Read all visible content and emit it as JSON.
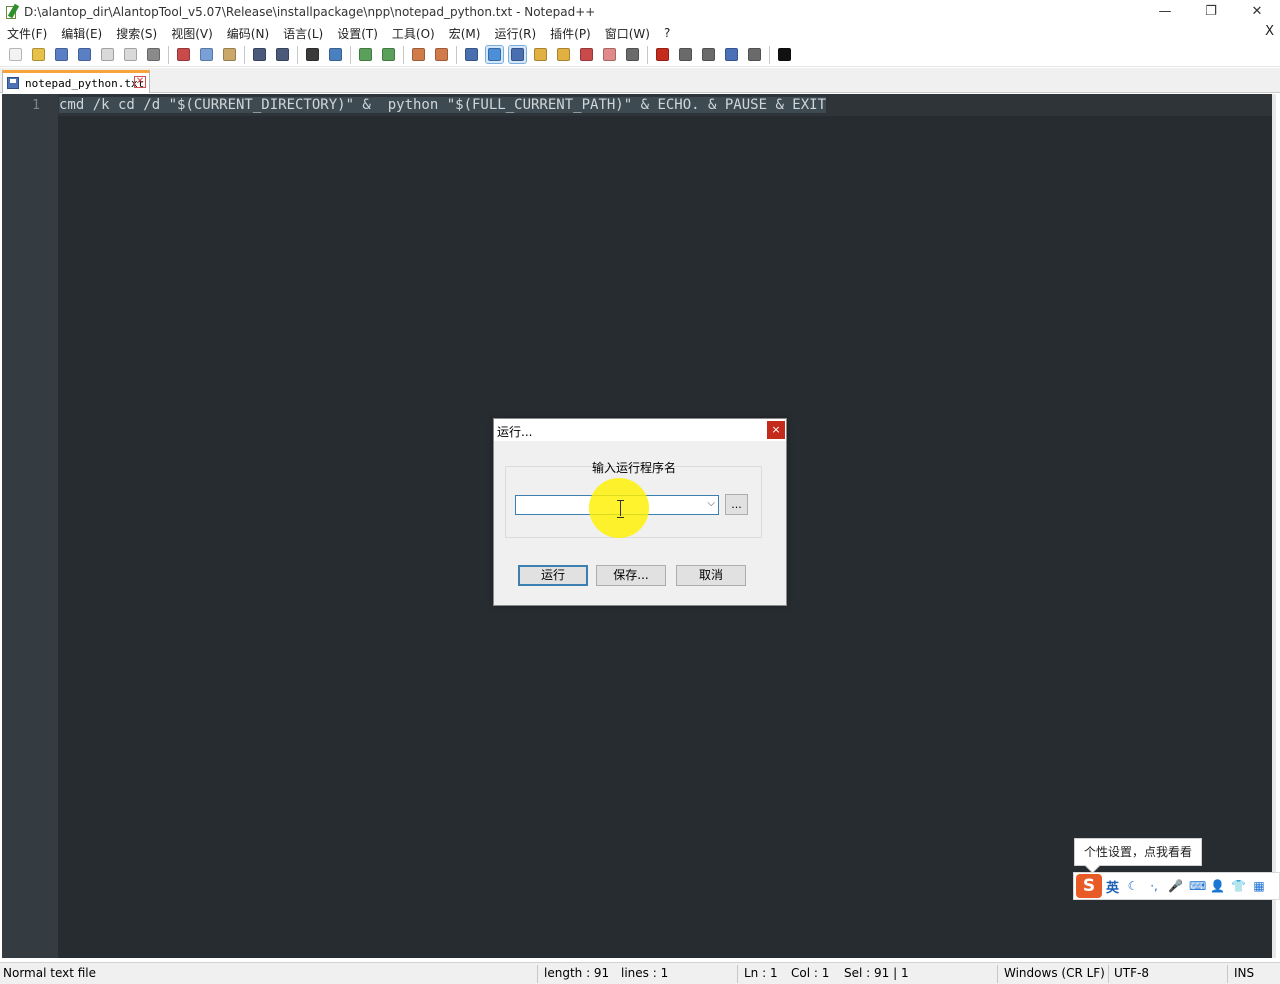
{
  "window": {
    "title": "D:\\alantop_dir\\AlantopTool_v5.07\\Release\\installpackage\\npp\\notepad_python.txt - Notepad++",
    "minimize": "—",
    "restore": "❐",
    "close": "✕"
  },
  "menu": {
    "items": [
      "文件(F)",
      "编辑(E)",
      "搜索(S)",
      "视图(V)",
      "编码(N)",
      "语言(L)",
      "设置(T)",
      "工具(O)",
      "宏(M)",
      "运行(R)",
      "插件(P)",
      "窗口(W)",
      "?"
    ],
    "close": "X"
  },
  "toolbar": {
    "icons": [
      {
        "name": "new-file-icon",
        "color": "#f2f2f2"
      },
      {
        "name": "open-file-icon",
        "color": "#e8c14a"
      },
      {
        "name": "save-icon",
        "color": "#5b7fc4"
      },
      {
        "name": "save-all-icon",
        "color": "#5b7fc4"
      },
      {
        "name": "close-icon",
        "color": "#d9d9d9"
      },
      {
        "name": "close-all-icon",
        "color": "#d9d9d9"
      },
      {
        "name": "print-icon",
        "color": "#8a8a8a"
      },
      {
        "sep": true
      },
      {
        "name": "cut-icon",
        "color": "#c94a4a"
      },
      {
        "name": "copy-icon",
        "color": "#7aa0d8"
      },
      {
        "name": "paste-icon",
        "color": "#c9a86a"
      },
      {
        "sep": true
      },
      {
        "name": "undo-icon",
        "color": "#4b5a7a"
      },
      {
        "name": "redo-icon",
        "color": "#4b5a7a"
      },
      {
        "sep": true
      },
      {
        "name": "find-icon",
        "color": "#3a3a3a"
      },
      {
        "name": "replace-icon",
        "color": "#4a80c0"
      },
      {
        "sep": true
      },
      {
        "name": "zoom-in-icon",
        "color": "#5aa05a"
      },
      {
        "name": "zoom-out-icon",
        "color": "#5aa05a"
      },
      {
        "sep": true
      },
      {
        "name": "sync-vertical-icon",
        "color": "#d27b4a"
      },
      {
        "name": "sync-horizontal-icon",
        "color": "#d27b4a"
      },
      {
        "sep": true
      },
      {
        "name": "word-wrap-icon",
        "color": "#4a6fb0"
      },
      {
        "name": "show-all-characters-icon",
        "color": "#4a8fd8",
        "active": true
      },
      {
        "name": "indent-guide-icon",
        "color": "#4a6fb0",
        "active": true
      },
      {
        "name": "language-icon",
        "color": "#e0b040"
      },
      {
        "name": "document-map-icon",
        "color": "#e0b040"
      },
      {
        "name": "function-list-icon",
        "color": "#c94a4a"
      },
      {
        "name": "folder-workspace-icon",
        "color": "#e08a8a"
      },
      {
        "name": "monitoring-icon",
        "color": "#6a6a6a"
      },
      {
        "sep": true
      },
      {
        "name": "record-macro-icon",
        "color": "#c42b1c"
      },
      {
        "name": "stop-macro-icon",
        "color": "#6a6a6a"
      },
      {
        "name": "play-macro-icon",
        "color": "#6a6a6a"
      },
      {
        "name": "run-macro-multiple-icon",
        "color": "#4a70b8"
      },
      {
        "name": "save-macro-icon",
        "color": "#6a6a6a"
      },
      {
        "sep": true
      },
      {
        "name": "markdown-icon",
        "color": "#111111"
      }
    ]
  },
  "tab": {
    "label": "notepad_python.txt",
    "close": "✕"
  },
  "editor": {
    "line_number": "1",
    "code": "cmd /k cd /d \"$(CURRENT_DIRECTORY)\" &  python \"$(FULL_CURRENT_PATH)\" & ECHO. & PAUSE & EXIT"
  },
  "run_dialog": {
    "title": "运行...",
    "close": "×",
    "prompt": "输入运行程序名",
    "program_value": "",
    "combo_arrow": "⌵",
    "browse": "...",
    "run": "运行",
    "save": "保存...",
    "cancel": "取消"
  },
  "ime": {
    "tooltip": "个性设置，点我看看",
    "logo": "S",
    "mode": "英",
    "icons": [
      "☾",
      "·,",
      "🎤",
      "⌨",
      "👤",
      "👕",
      "▦"
    ]
  },
  "statusbar": {
    "file_type": "Normal text file",
    "length": "length : 91",
    "lines": "lines : 1",
    "ln": "Ln : 1",
    "col": "Col : 1",
    "sel": "Sel : 91 | 1",
    "eol": "Windows (CR LF)",
    "encoding": "UTF-8",
    "insert_mode": "INS"
  }
}
